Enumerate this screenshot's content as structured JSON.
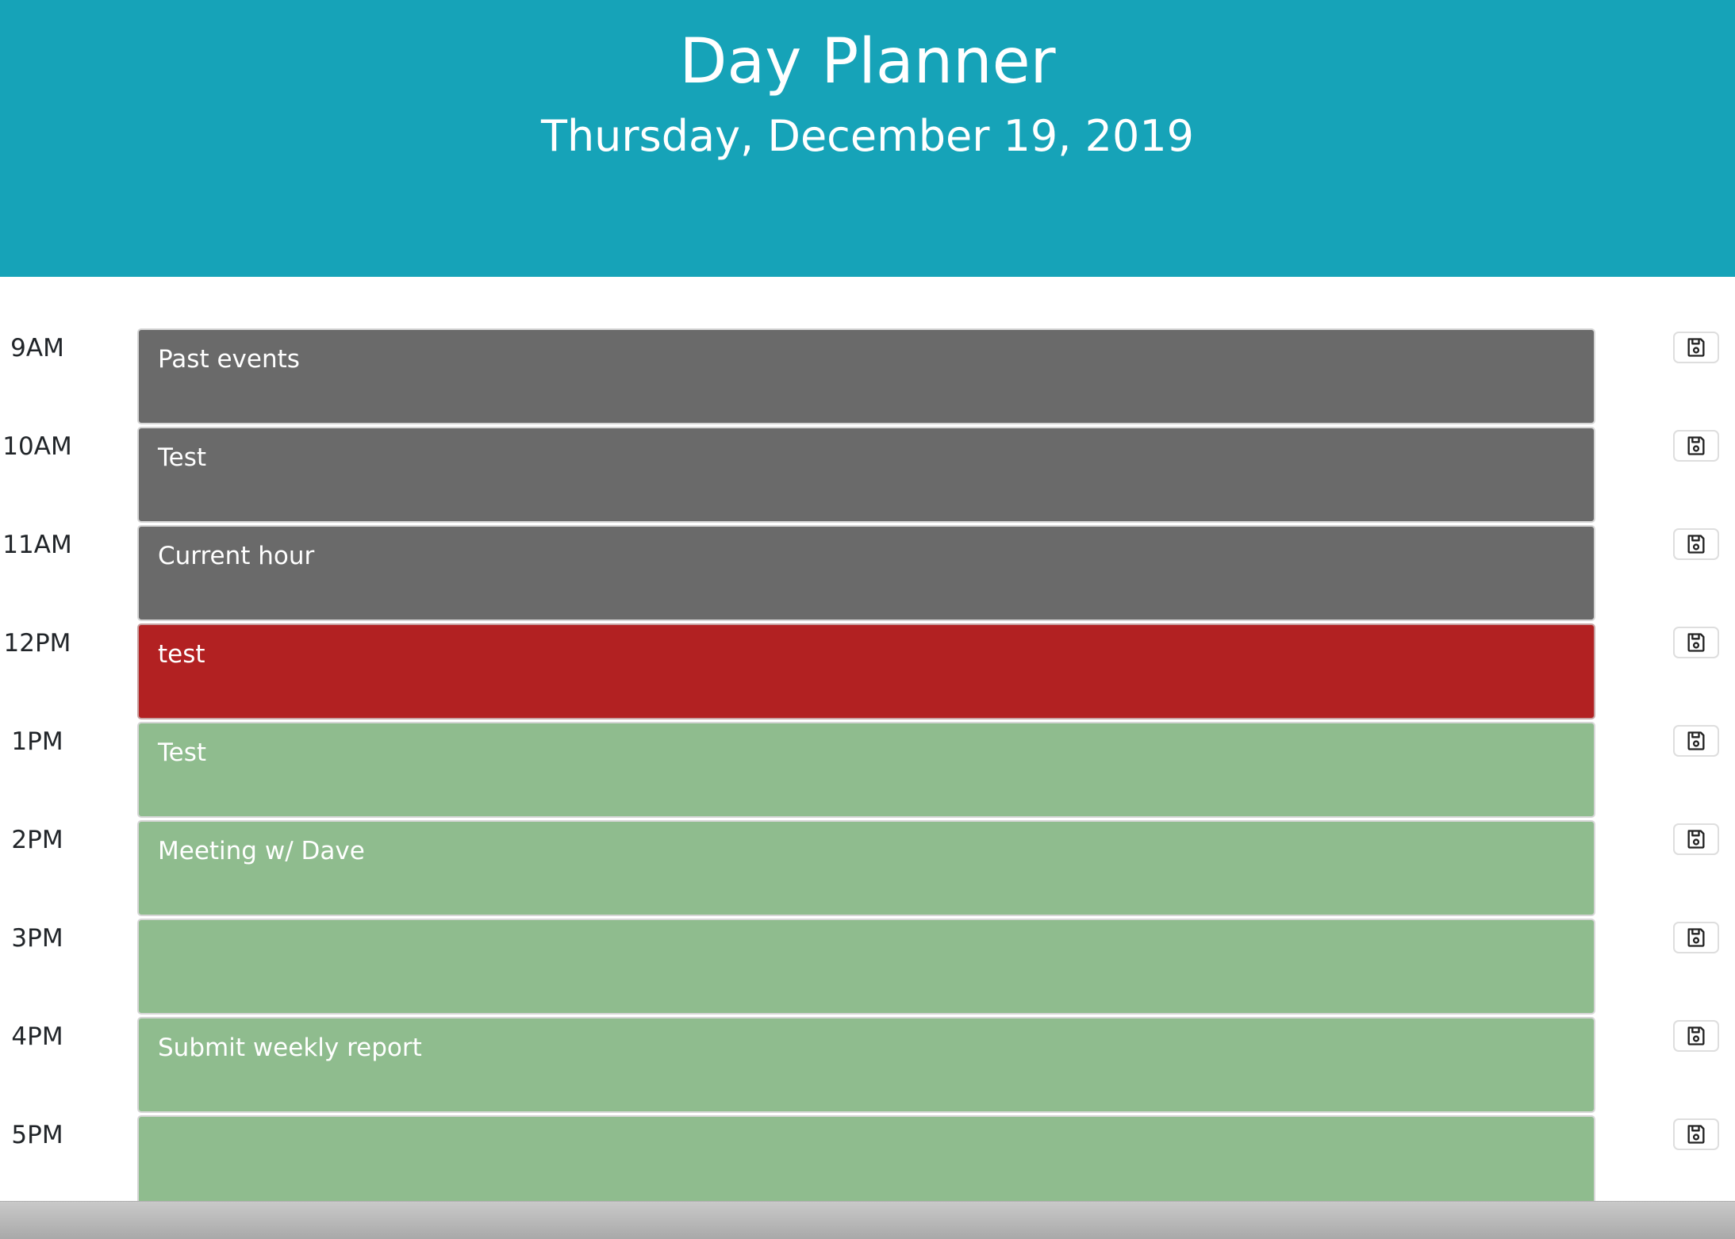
{
  "header": {
    "title": "Day Planner",
    "date": "Thursday, December 19, 2019",
    "background_color": "#16a3b8"
  },
  "colors": {
    "past": "#6a6a6a",
    "present": "#b22122",
    "future": "#8fbc8e"
  },
  "rows": [
    {
      "hour": "9AM",
      "text": "Past events",
      "status": "past"
    },
    {
      "hour": "10AM",
      "text": "Test",
      "status": "past"
    },
    {
      "hour": "11AM",
      "text": "Current hour",
      "status": "past"
    },
    {
      "hour": "12PM",
      "text": "test",
      "status": "present"
    },
    {
      "hour": "1PM",
      "text": "Test",
      "status": "future"
    },
    {
      "hour": "2PM",
      "text": "Meeting w/ Dave",
      "status": "future"
    },
    {
      "hour": "3PM",
      "text": "",
      "status": "future"
    },
    {
      "hour": "4PM",
      "text": "Submit weekly report",
      "status": "future"
    },
    {
      "hour": "5PM",
      "text": "",
      "status": "future"
    }
  ],
  "save_icon": "floppy-disk-icon"
}
